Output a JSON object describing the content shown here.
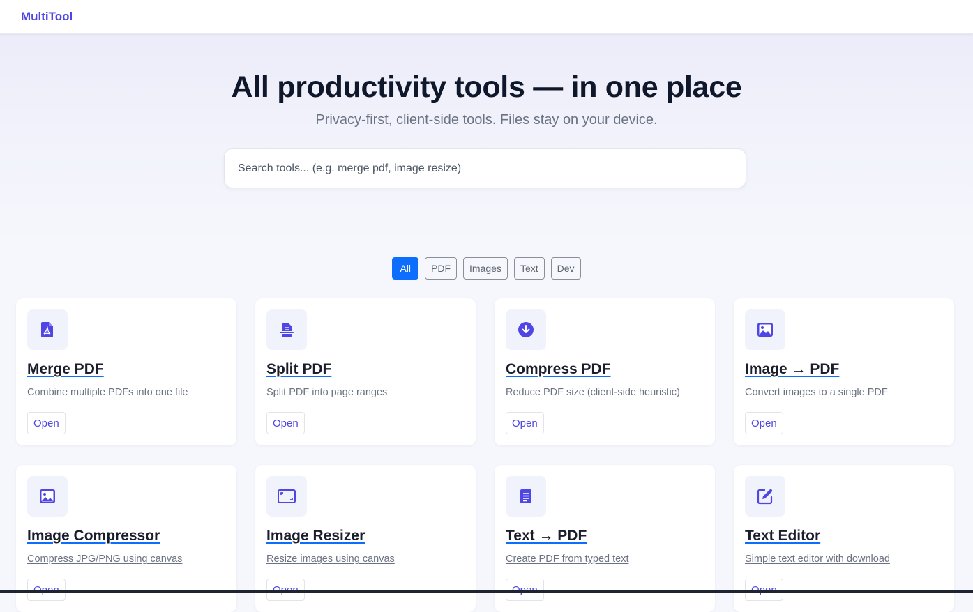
{
  "header": {
    "brand": "MultiTool"
  },
  "hero": {
    "title": "All productivity tools — in one place",
    "subtitle": "Privacy-first, client-side tools. Files stay on your device.",
    "search_placeholder": "Search tools... (e.g. merge pdf, image resize)"
  },
  "filters": [
    {
      "label": "All",
      "active": true
    },
    {
      "label": "PDF",
      "active": false
    },
    {
      "label": "Images",
      "active": false
    },
    {
      "label": "Text",
      "active": false
    },
    {
      "label": "Dev",
      "active": false
    }
  ],
  "tools": [
    {
      "title": "Merge PDF",
      "desc": "Combine multiple PDFs into one file",
      "action": "Open",
      "icon": "pdf-file-icon"
    },
    {
      "title": "Split PDF",
      "desc": "Split PDF into page ranges",
      "action": "Open",
      "icon": "file-split-icon"
    },
    {
      "title": "Compress PDF",
      "desc": "Reduce PDF size (client-side heuristic)",
      "action": "Open",
      "icon": "download-circle-icon"
    },
    {
      "title": "Image → PDF",
      "desc": "Convert images to a single PDF",
      "action": "Open",
      "icon": "image-icon"
    },
    {
      "title": "Image Compressor",
      "desc": "Compress JPG/PNG using canvas",
      "action": "Open",
      "icon": "image-icon"
    },
    {
      "title": "Image Resizer",
      "desc": "Resize images using canvas",
      "action": "Open",
      "icon": "resize-icon"
    },
    {
      "title": "Text → PDF",
      "desc": "Create PDF from typed text",
      "action": "Open",
      "icon": "document-text-icon"
    },
    {
      "title": "Text Editor",
      "desc": "Simple text editor with download",
      "action": "Open",
      "icon": "edit-icon"
    }
  ],
  "colors": {
    "brand": "#4f46e5",
    "accent": "#0d6efd",
    "icon": "#4f46e5"
  }
}
